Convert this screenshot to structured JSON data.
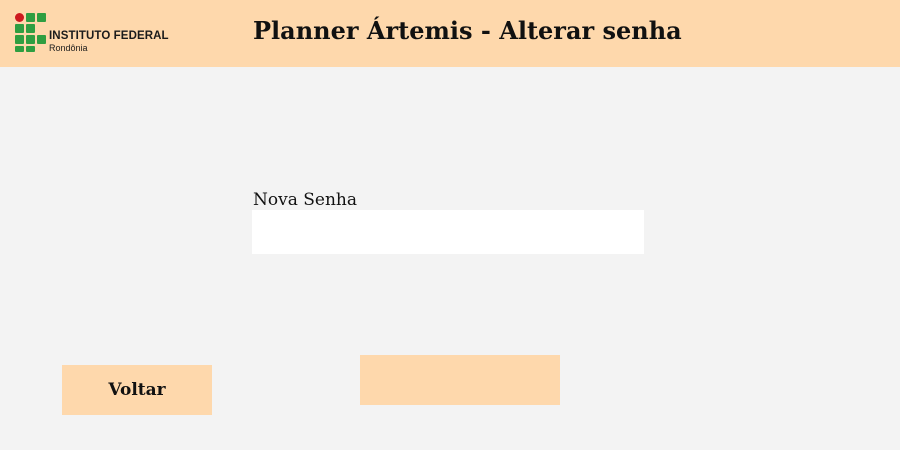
{
  "header": {
    "logo": {
      "name": "INSTITUTO FEDERAL",
      "subtitle": "Rondônia",
      "colors": {
        "green": "#2f9e41",
        "red": "#cd191e"
      }
    },
    "title": "Planner Ártemis - Alterar senha",
    "background": "#fed8ac"
  },
  "form": {
    "new_password_label": "Nova Senha",
    "new_password_value": "",
    "submit_label": ""
  },
  "actions": {
    "back_label": "Voltar"
  },
  "colors": {
    "page_background": "#f3f3f3",
    "accent": "#fed8ac",
    "input_background": "#ffffff"
  }
}
